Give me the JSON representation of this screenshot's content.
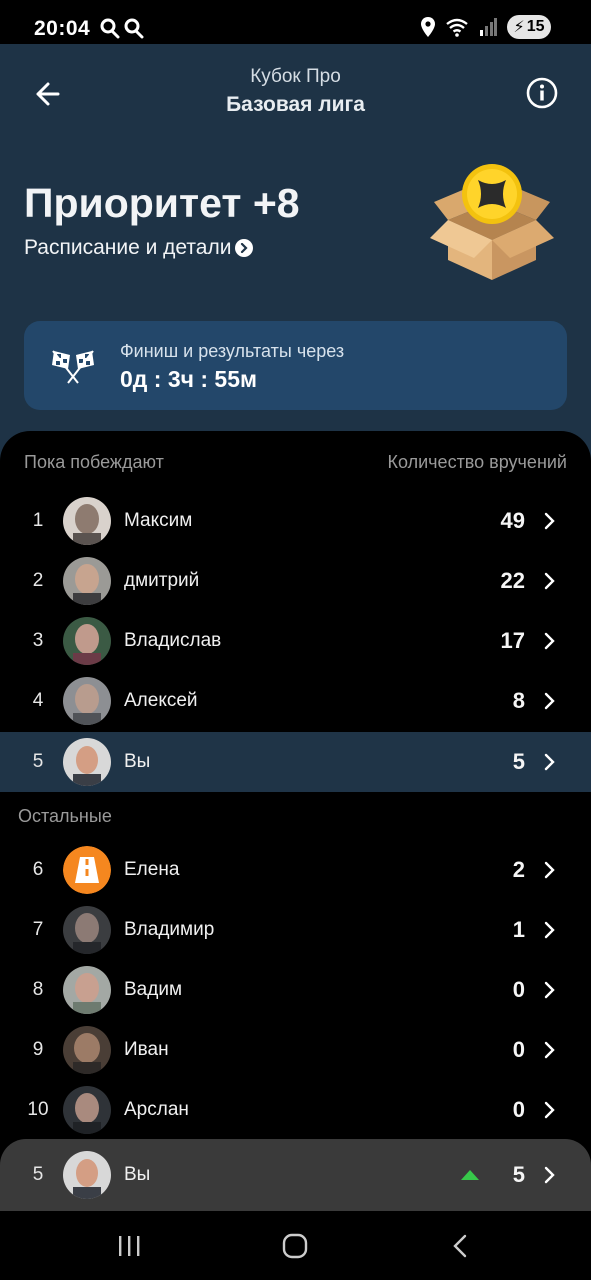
{
  "status_bar": {
    "time": "20:04",
    "battery": "15"
  },
  "header": {
    "subtitle": "Кубок Про",
    "title": "Базовая лига"
  },
  "hero": {
    "priority": "Приоритет +8",
    "schedule_link": "Расписание и детали"
  },
  "finish": {
    "label": "Финиш и результаты через",
    "time": "0д : 3ч : 55м"
  },
  "leaderboard": {
    "winners_label": "Пока побеждают",
    "count_label": "Количество вручений",
    "others_label": "Остальные",
    "winners": [
      {
        "rank": "1",
        "name": "Максим",
        "count": "49"
      },
      {
        "rank": "2",
        "name": "дмитрий",
        "count": "22"
      },
      {
        "rank": "3",
        "name": "Владислав",
        "count": "17"
      },
      {
        "rank": "4",
        "name": "Алексей",
        "count": "8"
      },
      {
        "rank": "5",
        "name": "Вы",
        "count": "5"
      }
    ],
    "others": [
      {
        "rank": "6",
        "name": "Елена",
        "count": "2"
      },
      {
        "rank": "7",
        "name": "Владимир",
        "count": "1"
      },
      {
        "rank": "8",
        "name": "Вадим",
        "count": "0"
      },
      {
        "rank": "9",
        "name": "Иван",
        "count": "0"
      },
      {
        "rank": "10",
        "name": "Арслан",
        "count": "0"
      }
    ],
    "me": {
      "rank": "5",
      "name": "Вы",
      "count": "5"
    }
  },
  "colors": {
    "header_bg": "#1e3346",
    "card_bg": "#23476a",
    "highlight_row": "#1f3447",
    "rise_arrow": "#37c84a",
    "avatar_orange": "#f5871f"
  }
}
